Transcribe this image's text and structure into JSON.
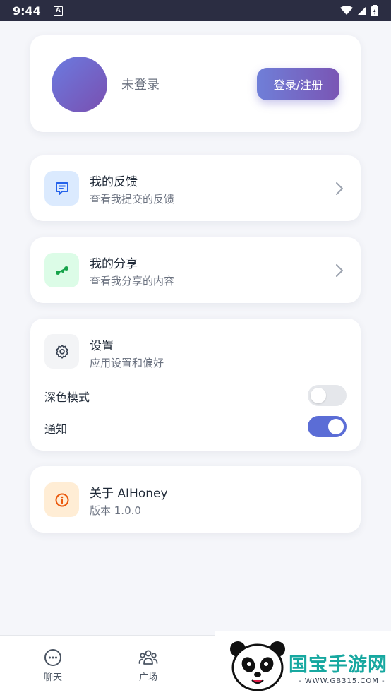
{
  "status_bar": {
    "time": "9:44",
    "notif_icon_letter": "A"
  },
  "profile": {
    "status_text": "未登录",
    "login_button_label": "登录/注册"
  },
  "menu": {
    "feedback": {
      "title": "我的反馈",
      "subtitle": "查看我提交的反馈",
      "icon": "feedback-icon",
      "icon_bg": "#dbeafe",
      "icon_color": "#2563eb"
    },
    "share": {
      "title": "我的分享",
      "subtitle": "查看我分享的内容",
      "icon": "share-icon",
      "icon_bg": "#dcfce7",
      "icon_color": "#16a34a"
    }
  },
  "settings": {
    "title": "设置",
    "subtitle": "应用设置和偏好",
    "icon": "gear-icon",
    "toggles": [
      {
        "label": "深色模式",
        "on": false
      },
      {
        "label": "通知",
        "on": true
      }
    ]
  },
  "about": {
    "title": "关于 AIHoney",
    "version": "版本 1.0.0",
    "icon": "info-icon",
    "icon_bg": "#ffedd5",
    "icon_color": "#ea580c"
  },
  "bottom_nav": [
    {
      "label": "聊天",
      "icon": "chat-bubble-icon"
    },
    {
      "label": "广场",
      "icon": "group-icon"
    }
  ],
  "watermark": {
    "title": "国宝手游网",
    "url": "- WWW.GB315.COM -"
  },
  "colors": {
    "accent": "#5b6dd6",
    "status_bar": "#2b2d42",
    "background": "#f5f6fa"
  }
}
